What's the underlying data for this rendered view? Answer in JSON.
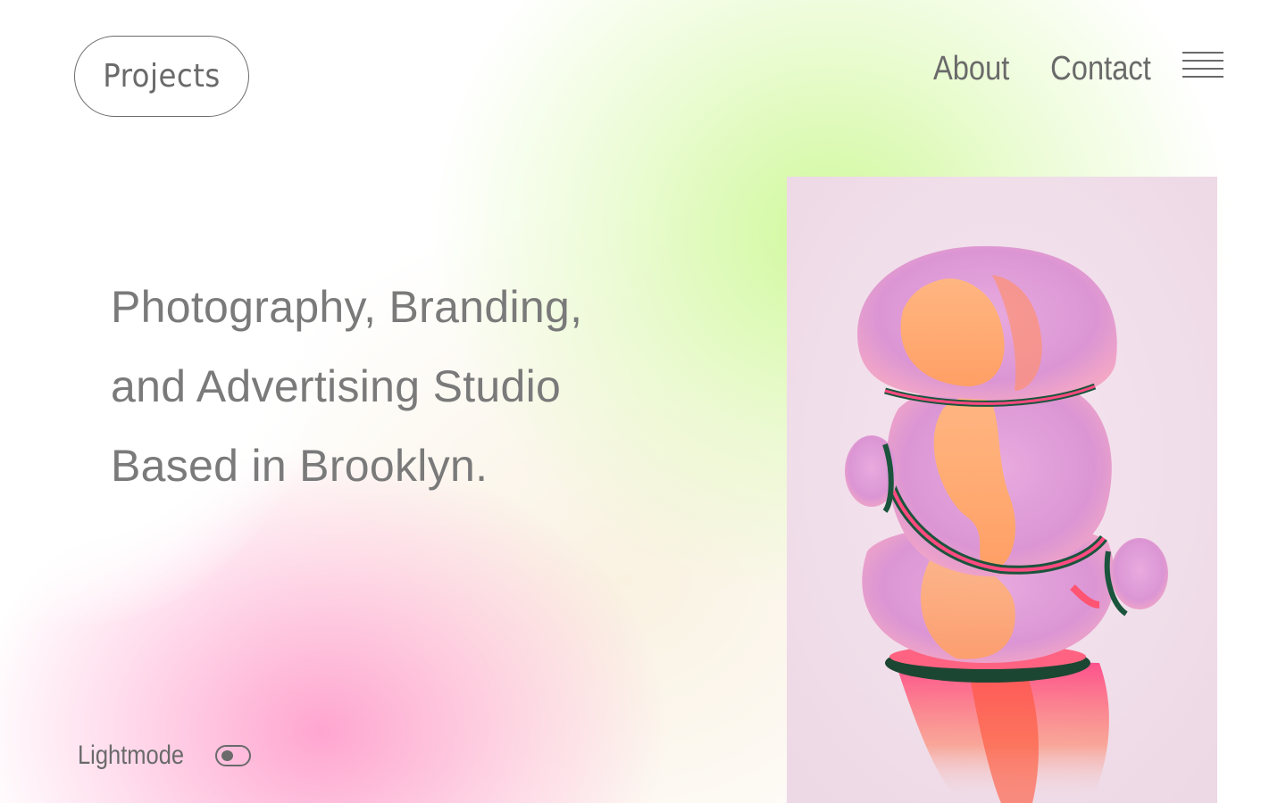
{
  "header": {
    "projects_label": "Projects",
    "nav": {
      "about_label": "About",
      "contact_label": "Contact",
      "menu_icon": "hamburger-menu-icon"
    }
  },
  "hero": {
    "headline_lines": [
      "Photography, Branding,",
      "and Advertising Studio",
      "Based in Brooklyn."
    ]
  },
  "featured_image": {
    "subject": "iridescent pink and orange blob sculpture"
  },
  "footer": {
    "lightmode_label": "Lightmode",
    "toggle_on": false
  },
  "colors": {
    "text": "#6a6a6a",
    "pink_glow": "#ff96c8",
    "green_glow": "#cdf896",
    "art_background": "#f2dfeb"
  }
}
